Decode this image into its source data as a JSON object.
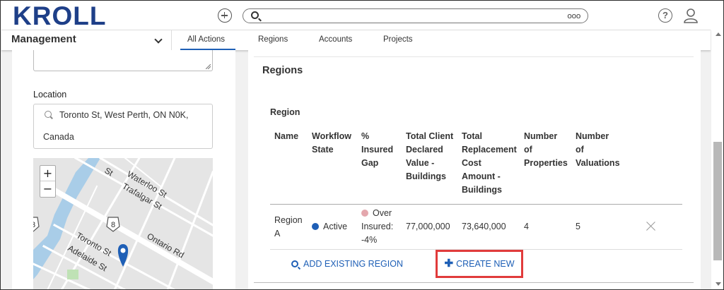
{
  "header": {
    "logo_text": "KROLL",
    "search_more": "ooo",
    "help_icon": "?"
  },
  "nav": {
    "module": "Management",
    "tabs": [
      {
        "label": "All Actions",
        "active": true
      },
      {
        "label": "Regions",
        "active": false
      },
      {
        "label": "Accounts",
        "active": false
      },
      {
        "label": "Projects",
        "active": false
      }
    ]
  },
  "left": {
    "location_label": "Location",
    "location_line1": "Toronto St, West Perth, ON N0K,",
    "location_line2": "Canada",
    "zoom_in": "+",
    "zoom_out": "−",
    "map_labels": {
      "waterloo": "Waterloo St",
      "trafalgar": "Trafalgar St",
      "toronto": "Toronto St",
      "ontario": "Ontario Rd",
      "adelaide": "Adelaide St",
      "st": "St",
      "shield_8": "8",
      "shield_3": "3"
    }
  },
  "regions": {
    "title": "Regions",
    "subtitle": "Region",
    "columns": [
      [
        "Name"
      ],
      [
        "Workflow",
        "State"
      ],
      [
        "%",
        "Insured",
        "Gap"
      ],
      [
        "Total Client",
        "Declared",
        "Value -",
        "Buildings"
      ],
      [
        "Total",
        "Replacement",
        "Cost",
        "Amount -",
        "Buildings"
      ],
      [
        "Number",
        "of",
        "Properties"
      ],
      [
        "Number",
        "of",
        "Valuations"
      ]
    ],
    "rows": [
      {
        "name": [
          "Region",
          "A"
        ],
        "state": "Active",
        "gap": [
          "Over",
          "Insured:",
          "-4%"
        ],
        "client_value": "77,000,000",
        "replacement_cost": "73,640,000",
        "properties": "4",
        "valuations": "5"
      }
    ],
    "add_existing_label": "ADD EXISTING REGION",
    "create_new_label": "CREATE NEW"
  },
  "colors": {
    "brand": "#1e3f88",
    "link": "#1e5fb6",
    "active_dot": "#1e5fb6",
    "gap_dot": "#e4a7ad",
    "highlight": "#e13b3b"
  }
}
